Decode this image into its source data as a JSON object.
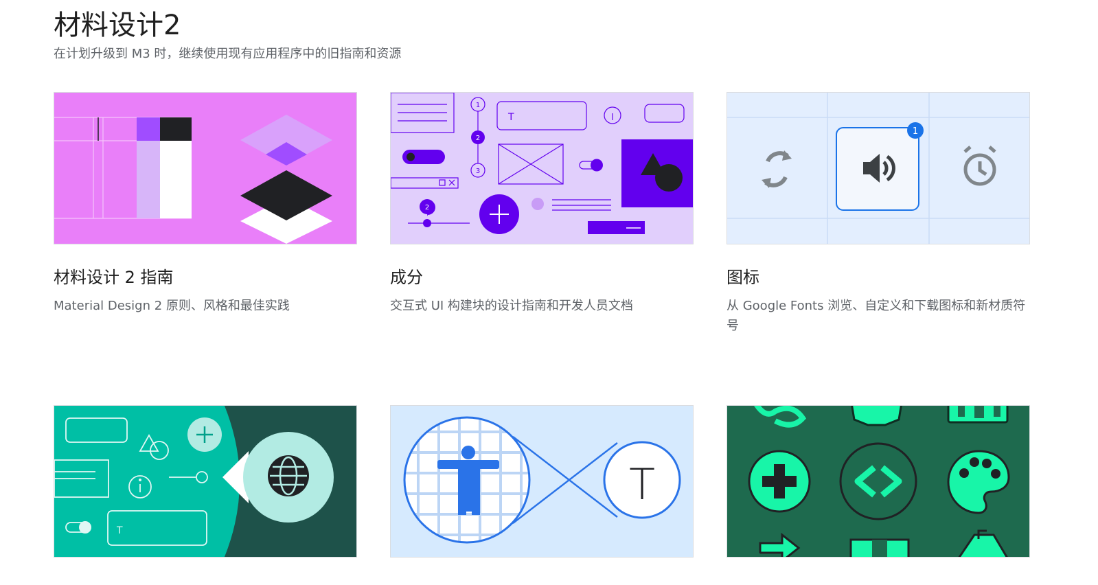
{
  "section": {
    "title": "材料设计2",
    "subtitle": "在计划升级到 M3 时，继续使用现有应用程序中的旧指南和资源"
  },
  "cards": [
    {
      "title": "材料设计 2 指南",
      "description": "Material Design 2 原则、风格和最佳实践"
    },
    {
      "title": "成分",
      "description": "交互式 UI 构建块的设计指南和开发人员文档"
    },
    {
      "title": "图标",
      "description": "从 Google Fonts 浏览、自定义和下载图标和新材质符号"
    },
    {
      "title": "",
      "description": ""
    },
    {
      "title": "",
      "description": ""
    },
    {
      "title": "",
      "description": ""
    }
  ],
  "illustrations": {
    "components": {
      "step_1": "1",
      "step_2": "2",
      "step_3": "3",
      "slider_badge": "2",
      "text_field_glyph": "T"
    },
    "icons": {
      "notification_count": "1"
    },
    "color": {
      "text_field_glyph": "T"
    },
    "accessibility": {
      "type_glyph": "T"
    }
  },
  "colors": {
    "guidelines_bg": "#e97ff9",
    "components_bg": "#e1cffc",
    "components_accent": "#6200ee",
    "icons_bg": "#e3eefe",
    "icons_accent": "#1a73e8",
    "color_bg_teal": "#00bfa5",
    "color_bg_dark": "#1e524a",
    "accessibility_bg": "#d6eafe",
    "accessibility_accent": "#2a73e8",
    "symbols_bg": "#1e6a4e",
    "symbols_accent": "#18f5a8"
  }
}
